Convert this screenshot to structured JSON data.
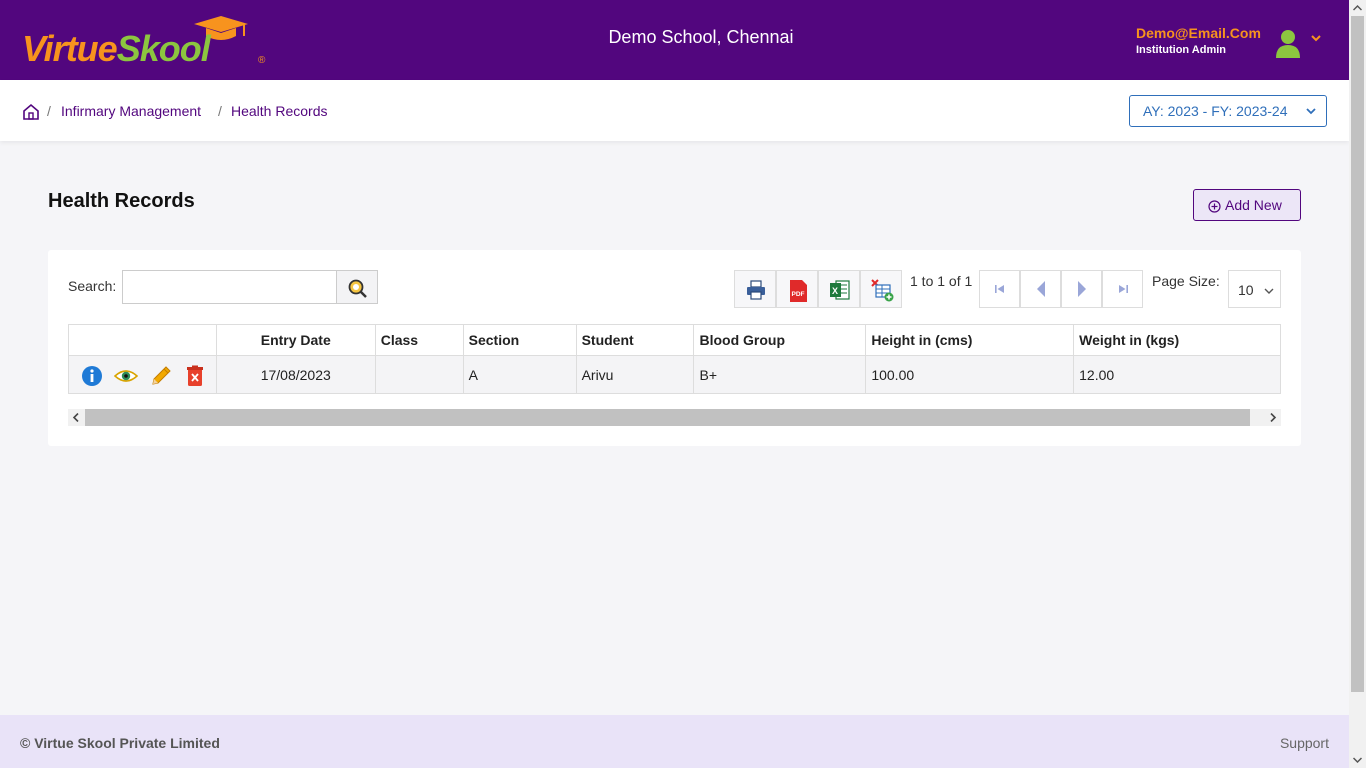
{
  "brand": {
    "logo_part1": "Virtue",
    "logo_part2": "Skool",
    "logo_reg": "®",
    "orange": "#f7931e",
    "green": "#8cc63f",
    "purple": "#52067e"
  },
  "header": {
    "school_name": "Demo School, Chennai",
    "user_email": "Demo@Email.Com",
    "user_role": "Institution Admin",
    "avatar_icon": "user-avatar-icon",
    "menu_icon": "chevron-down-icon"
  },
  "breadcrumb": {
    "home_icon": "home-icon",
    "separator": "/",
    "items": [
      "Infirmary Management",
      "Health Records"
    ]
  },
  "academic_year": {
    "selected": "AY: 2023 - FY: 2023-24"
  },
  "page": {
    "title": "Health Records",
    "add_new_label": "Add New"
  },
  "toolbar": {
    "search_label": "Search:",
    "search_value": "",
    "search_placeholder": "",
    "export_icons": [
      "print-icon",
      "pdf-icon",
      "excel-icon",
      "excel-add-icon"
    ],
    "paging_text": "1 to 1 of 1",
    "page_size_label": "Page Size:",
    "page_size_value": "10"
  },
  "table": {
    "columns": [
      "",
      "Entry Date",
      "Class",
      "Section",
      "Student",
      "Blood Group",
      "Height in (cms)",
      "Weight in (kgs)"
    ],
    "rows": [
      {
        "entry_date": "17/08/2023",
        "class": "",
        "section": "A",
        "student": "Arivu",
        "blood_group": "B+",
        "height": "100.00",
        "weight": "12.00"
      }
    ],
    "row_action_icons": [
      "info-icon",
      "view-eye-icon",
      "edit-pencil-icon",
      "delete-icon"
    ]
  },
  "footer": {
    "copyright": "© Virtue Skool Private Limited",
    "support": "Support"
  }
}
